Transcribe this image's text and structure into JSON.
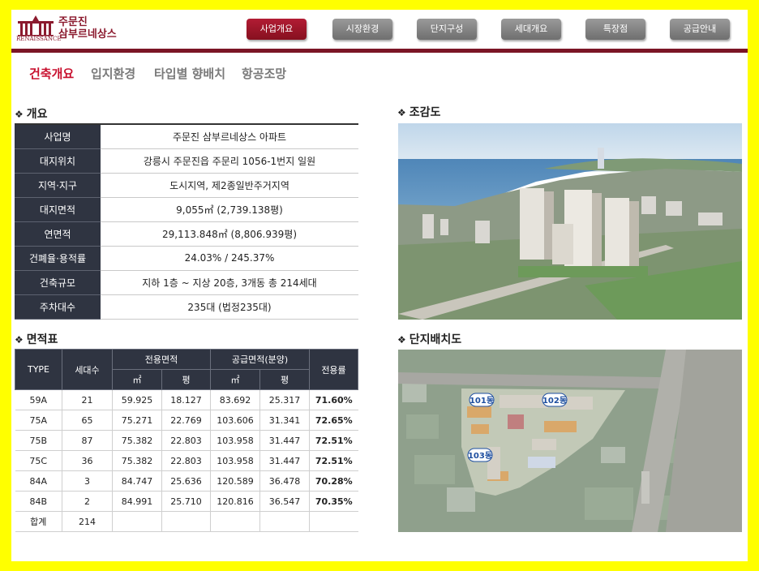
{
  "brand": {
    "name_en": "RENAISSANCE",
    "name_ko_line1": "주문진",
    "name_ko_line2": "삼부르네상스"
  },
  "nav": [
    {
      "label": "사업개요",
      "active": true
    },
    {
      "label": "시장환경",
      "active": false
    },
    {
      "label": "단지구성",
      "active": false
    },
    {
      "label": "세대개요",
      "active": false
    },
    {
      "label": "특장점",
      "active": false
    },
    {
      "label": "공급안내",
      "active": false
    }
  ],
  "subtabs": [
    {
      "label": "건축개요",
      "active": true
    },
    {
      "label": "입지환경",
      "active": false
    },
    {
      "label": "타입별 향배치",
      "active": false
    },
    {
      "label": "항공조망",
      "active": false
    }
  ],
  "overview": {
    "title": "개요",
    "rows": [
      {
        "key": "사업명",
        "value": "주문진 삼부르네상스 아파트"
      },
      {
        "key": "대지위치",
        "value": "강릉시 주문진읍 주문리 1056-1번지 일원"
      },
      {
        "key": "지역·지구",
        "value": "도시지역, 제2종일반주거지역"
      },
      {
        "key": "대지면적",
        "value": "9,055㎡ (2,739.138평)"
      },
      {
        "key": "연면적",
        "value": "29,113.848㎡ (8,806.939평)"
      },
      {
        "key": "건폐율·용적률",
        "value": "24.03% / 245.37%"
      },
      {
        "key": "건축규모",
        "value": "지하 1층 ~ 지상 20층, 3개동  총 214세대"
      },
      {
        "key": "주차대수",
        "value": "235대 (법정235대)"
      }
    ]
  },
  "area": {
    "title": "면적표",
    "headers": {
      "type": "TYPE",
      "units": "세대수",
      "exclusive": "전용면적",
      "supply": "공급면적(분양)",
      "ratio": "전용률",
      "m2": "㎡",
      "pyeong": "평"
    },
    "rows": [
      {
        "type": "59A",
        "units": "21",
        "ex_m2": "59.925",
        "ex_py": "18.127",
        "su_m2": "83.692",
        "su_py": "25.317",
        "ratio": "71.60%"
      },
      {
        "type": "75A",
        "units": "65",
        "ex_m2": "75.271",
        "ex_py": "22.769",
        "su_m2": "103.606",
        "su_py": "31.341",
        "ratio": "72.65%"
      },
      {
        "type": "75B",
        "units": "87",
        "ex_m2": "75.382",
        "ex_py": "22.803",
        "su_m2": "103.958",
        "su_py": "31.447",
        "ratio": "72.51%"
      },
      {
        "type": "75C",
        "units": "36",
        "ex_m2": "75.382",
        "ex_py": "22.803",
        "su_m2": "103.958",
        "su_py": "31.447",
        "ratio": "72.51%"
      },
      {
        "type": "84A",
        "units": "3",
        "ex_m2": "84.747",
        "ex_py": "25.636",
        "su_m2": "120.589",
        "su_py": "36.478",
        "ratio": "70.28%"
      },
      {
        "type": "84B",
        "units": "2",
        "ex_m2": "84.991",
        "ex_py": "25.710",
        "su_m2": "120.816",
        "su_py": "36.547",
        "ratio": "70.35%"
      }
    ],
    "total": {
      "label": "합계",
      "units": "214"
    }
  },
  "birdseye": {
    "title": "조감도"
  },
  "siteplan": {
    "title": "단지배치도",
    "buildings": [
      "101동",
      "102동",
      "103동"
    ]
  },
  "colors": {
    "brand": "#8b1a2e",
    "accent": "#c8102e",
    "table_header": "#2f3441",
    "frame": "#ffff00"
  }
}
